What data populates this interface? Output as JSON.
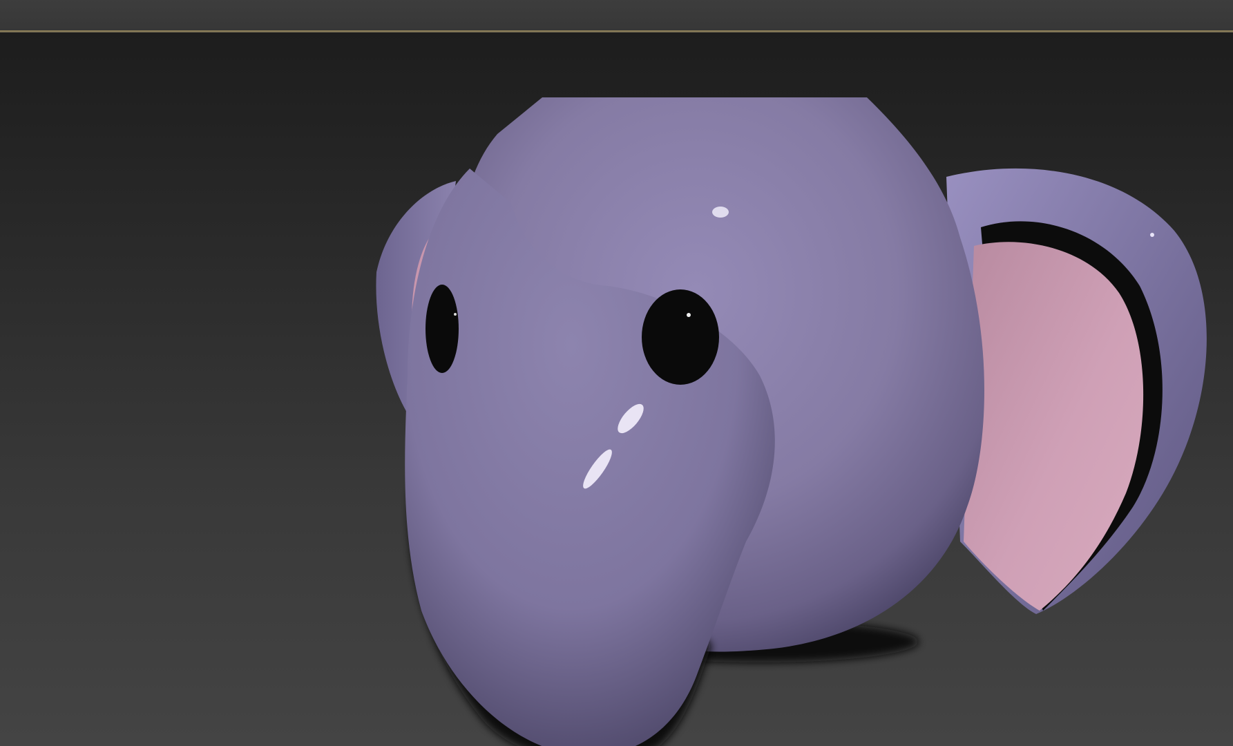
{
  "window": {
    "active_border_color": "#9c8c5a"
  },
  "viewport": {
    "background_top": "#1d1d1d",
    "background_bottom": "#444444"
  },
  "model": {
    "body_color": "#8a80a8",
    "ear_inner_color": "#c99ab0",
    "eye_color": "#0a0a0a"
  }
}
